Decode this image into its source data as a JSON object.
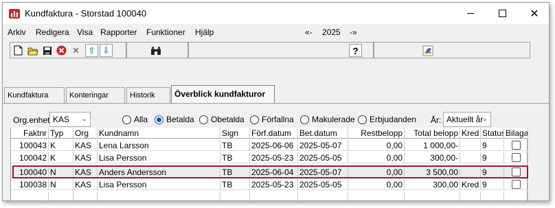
{
  "window": {
    "title": "Kundfaktura - Storstad 100040",
    "close_glyph": "✕"
  },
  "menu": {
    "items": [
      "Arkiv",
      "Redigera",
      "Visa",
      "Rapporter",
      "Funktioner",
      "Hjälp"
    ],
    "year_prev": "«-",
    "year": "2025",
    "year_next": "-»"
  },
  "toolbar": {
    "icons": [
      "new-document-icon",
      "open-folder-icon",
      "save-icon",
      "cancel-icon",
      "delete-icon",
      "arrow-up-icon",
      "arrow-down-icon",
      "binoculars-icon",
      "help-icon",
      "palette-icon"
    ],
    "glyphs": {
      "help": "?",
      "binoculars": "🔭",
      "delete": "✕",
      "up": "⇧",
      "down": "⇩"
    }
  },
  "tabs": [
    {
      "label": "Kundfaktura",
      "active": false
    },
    {
      "label": "Konteringar",
      "active": false
    },
    {
      "label": "Historik",
      "active": false
    },
    {
      "label": "Överblick kundfakturor",
      "active": true
    }
  ],
  "filters": {
    "org_label": "Org.enhet:",
    "org_value": "KAS",
    "radios": [
      {
        "label": "Alla",
        "checked": false
      },
      {
        "label": "Betalda",
        "checked": true
      },
      {
        "label": "Obetalda",
        "checked": false
      },
      {
        "label": "Förfallna",
        "checked": false
      },
      {
        "label": "Makulerade",
        "checked": false
      },
      {
        "label": "Erbjudanden",
        "checked": false
      }
    ],
    "year_label": "År:",
    "year_value": "Aktuellt år"
  },
  "grid": {
    "columns": [
      "Faktnr",
      "Typ",
      "Org",
      "Kundnamn",
      "Sign",
      "Förf.datum",
      "Bet.datum",
      "Restbelopp",
      "Total belopp",
      "Kred",
      "Status",
      "Bilaga"
    ],
    "rows": [
      [
        "100043",
        "K",
        "KAS",
        "Lena Larsson",
        "TB",
        "2025-06-06",
        "2025-05-07",
        "0,00",
        "1 000,00-",
        "",
        "9",
        ""
      ],
      [
        "100042",
        "K",
        "KAS",
        "Lisa Persson",
        "TB",
        "2025-05-23",
        "2025-05-05",
        "0,00",
        "300,00-",
        "",
        "9",
        ""
      ],
      [
        "100040",
        "N",
        "KAS",
        "Anders Andersson",
        "TB",
        "2025-06-04",
        "2025-05-07",
        "0,00",
        "3 500,00",
        "",
        "9",
        ""
      ],
      [
        "100038",
        "N",
        "KAS",
        "Lisa Persson",
        "TB",
        "2025-05-23",
        "2025-05-05",
        "0,00",
        "300,00",
        "Kred",
        "9",
        ""
      ]
    ],
    "selected_row": 2
  },
  "colors": {
    "accent": "#0060c0",
    "selection_outline": "#8e1b3a",
    "app_icon": "#c62828"
  }
}
